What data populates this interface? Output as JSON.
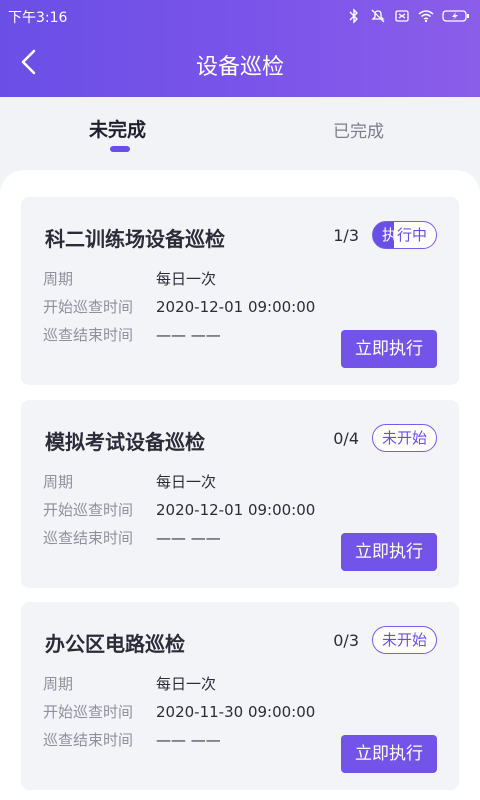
{
  "status": {
    "time": "下午3:16"
  },
  "header": {
    "title": "设备巡检"
  },
  "tabs": [
    {
      "label": "未完成"
    },
    {
      "label": "已完成"
    }
  ],
  "labels": {
    "cycle": "周期",
    "start": "开始巡查时间",
    "end": "巡查结束时间",
    "exec": "立即执行"
  },
  "cards": [
    {
      "title": "科二训练场设备巡检",
      "progress": "1/3",
      "badge_a": "执",
      "badge_b": "行中",
      "cycle": "每日一次",
      "start": "2020-12-01 09:00:00",
      "end": "—— ——"
    },
    {
      "title": "模拟考试设备巡检",
      "progress": "0/4",
      "badge": "未开始",
      "cycle": "每日一次",
      "start": "2020-12-01 09:00:00",
      "end": "—— ——"
    },
    {
      "title": "办公区电路巡检",
      "progress": "0/3",
      "badge": "未开始",
      "cycle": "每日一次",
      "start": "2020-11-30 09:00:00",
      "end": "—— ——"
    }
  ],
  "colors": {
    "accent": "#6a4fe6",
    "button": "#7354e8",
    "card_bg": "#f3f4f8"
  }
}
